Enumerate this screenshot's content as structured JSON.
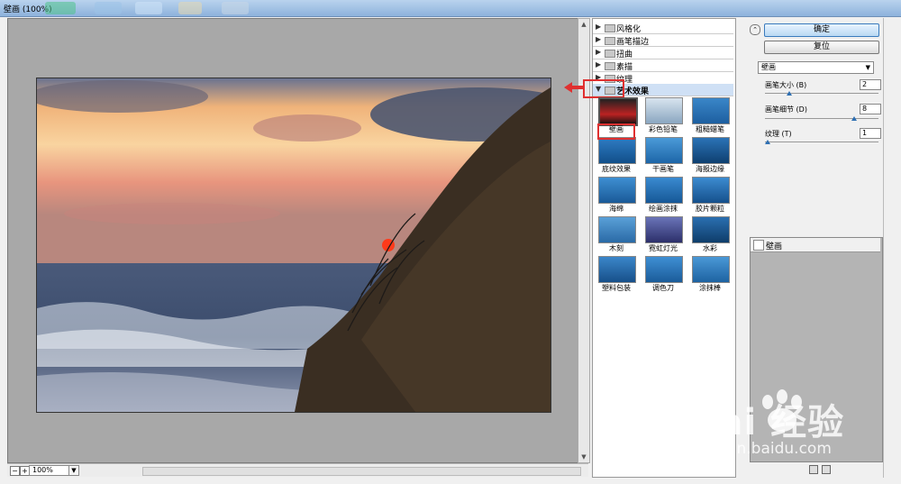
{
  "window": {
    "title": "壁画 (100%)"
  },
  "preview": {
    "zoom": "100%"
  },
  "filter_folders": [
    {
      "label": "风格化",
      "expanded": false
    },
    {
      "label": "画笔描边",
      "expanded": false
    },
    {
      "label": "扭曲",
      "expanded": false
    },
    {
      "label": "素描",
      "expanded": false
    },
    {
      "label": "纹理",
      "expanded": false
    },
    {
      "label": "艺术效果",
      "expanded": true
    }
  ],
  "thumbnails": [
    {
      "label": "壁画",
      "selected": true
    },
    {
      "label": "彩色铅笔",
      "selected": false
    },
    {
      "label": "粗糙蜡笔",
      "selected": false
    },
    {
      "label": "底纹效果",
      "selected": false
    },
    {
      "label": "干画笔",
      "selected": false
    },
    {
      "label": "海报边缘",
      "selected": false
    },
    {
      "label": "海绵",
      "selected": false
    },
    {
      "label": "绘画涂抹",
      "selected": false
    },
    {
      "label": "胶片颗粒",
      "selected": false
    },
    {
      "label": "木刻",
      "selected": false
    },
    {
      "label": "霓虹灯光",
      "selected": false
    },
    {
      "label": "水彩",
      "selected": false
    },
    {
      "label": "塑料包装",
      "selected": false
    },
    {
      "label": "调色刀",
      "selected": false
    },
    {
      "label": "涂抹棒",
      "selected": false
    }
  ],
  "buttons": {
    "ok": "确定",
    "reset": "复位"
  },
  "filter_select": {
    "value": "壁画"
  },
  "params": [
    {
      "label": "画笔大小 (B)",
      "value": "2",
      "fraction": 0.2
    },
    {
      "label": "画笔细节 (D)",
      "value": "8",
      "fraction": 0.8
    },
    {
      "label": "纹理 (T)",
      "value": "1",
      "fraction": 0.0
    }
  ],
  "layers": [
    {
      "name": "壁画"
    }
  ],
  "watermark": {
    "brand": "Bai  经验",
    "url": "jingyan.baidu.com"
  },
  "colors": {
    "highlight": "#e03030",
    "accent": "#2e6fb2"
  }
}
